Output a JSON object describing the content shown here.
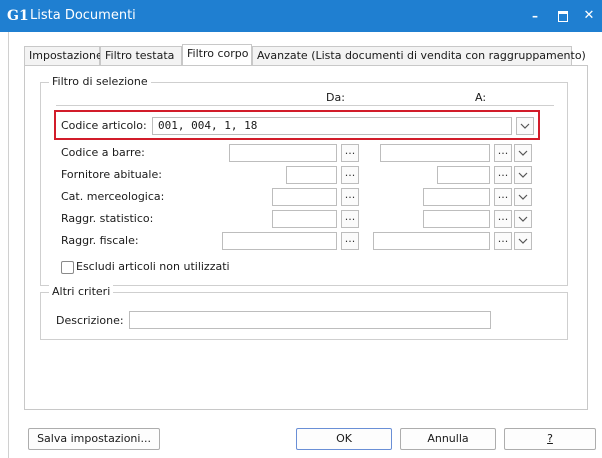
{
  "window": {
    "logo": "G1",
    "title": "Lista Documenti",
    "minimize": "–",
    "close": "✕"
  },
  "tabs": [
    {
      "label": "Impostazione"
    },
    {
      "label": "Filtro testata"
    },
    {
      "label": "Filtro corpo",
      "active": true
    },
    {
      "label": "Avanzate (Lista documenti di vendita con raggruppamento)"
    }
  ],
  "selection_filter": {
    "title": "Filtro di selezione",
    "col_from": "Da:",
    "col_to": "A:",
    "codice_articolo": {
      "label": "Codice articolo:",
      "value": "001, 004, 1, 18"
    },
    "codice_barre": {
      "label": "Codice a barre:"
    },
    "fornitore": {
      "label": "Fornitore abituale:"
    },
    "cat_merceologica": {
      "label": "Cat. merceologica:"
    },
    "raggr_statistico": {
      "label": "Raggr. statistico:"
    },
    "raggr_fiscale": {
      "label": "Raggr. fiscale:"
    },
    "escludi": {
      "label": "Escludi articoli non utilizzati",
      "checked": false
    },
    "dots_label": "..."
  },
  "other_criteria": {
    "title": "Altri criteri",
    "descrizione": {
      "label": "Descrizione:",
      "value": ""
    }
  },
  "buttons": {
    "save": "Salva impostazioni...",
    "ok": "OK",
    "cancel": "Annulla",
    "help": "?"
  },
  "colors": {
    "titlebar": "#1f7fd1",
    "highlight": "#d21c2a"
  }
}
